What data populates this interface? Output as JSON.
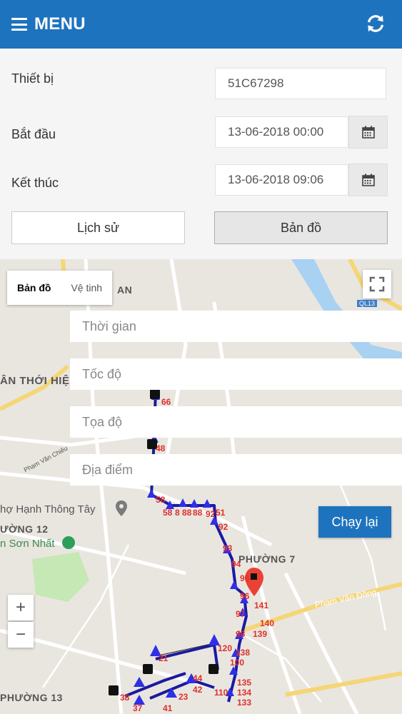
{
  "header": {
    "menu_label": "MENU",
    "menu_icon": "hamburger-icon",
    "refresh_icon": "refresh-icon"
  },
  "form": {
    "device_label": "Thiết bị",
    "device_value": "51C67298",
    "start_label": "Bắt đầu",
    "start_value": "13-06-2018 00:00",
    "end_label": "Kết thúc",
    "end_value": "13-06-2018 09:06",
    "calendar_icon": "calendar-icon",
    "history_button": "Lịch sử",
    "map_button": "Bản đồ"
  },
  "map": {
    "map_type": [
      "Bản đồ",
      "Vệ tinh"
    ],
    "info_fields": {
      "time": "Thời gian",
      "speed": "Tốc độ",
      "coords": "Tọa độ",
      "location": "Địa điểm"
    },
    "replay_button": "Chạy lại",
    "zoom_in": "+",
    "zoom_out": "−",
    "labels": {
      "thoi_hiep": "ÂN THỚI HIỆ",
      "an": "AN",
      "phuong12": "ƯỜNG 12",
      "phuong7": "PHƯỜNG 7",
      "phuong13": "PHƯỜNG 13",
      "hanh_thong_tay": "hợ Hạnh Thông Tây",
      "son_nhat": "n Sơn Nhất",
      "pham_van_dong": "Phạm Văn Đồng",
      "pham_van_chieu": "Phạm Văn Chiêu",
      "ql13": "QL13"
    },
    "track_numbers": [
      "66",
      "48",
      "58",
      "58",
      "8",
      "88",
      "88",
      "92",
      "51",
      "92",
      "93",
      "94",
      "96",
      "96",
      "141",
      "97",
      "98",
      "139",
      "140",
      "138",
      "120",
      "100",
      "21",
      "135",
      "134",
      "133",
      "42",
      "38",
      "41",
      "37",
      "23",
      "44",
      "110"
    ],
    "colors": {
      "route": "#1a1aa0",
      "arrow": "#2f2fe6",
      "marker": "#e94234",
      "road_yellow": "#f5d676",
      "water": "#a8d1f2",
      "park": "#c6e8b4"
    }
  }
}
